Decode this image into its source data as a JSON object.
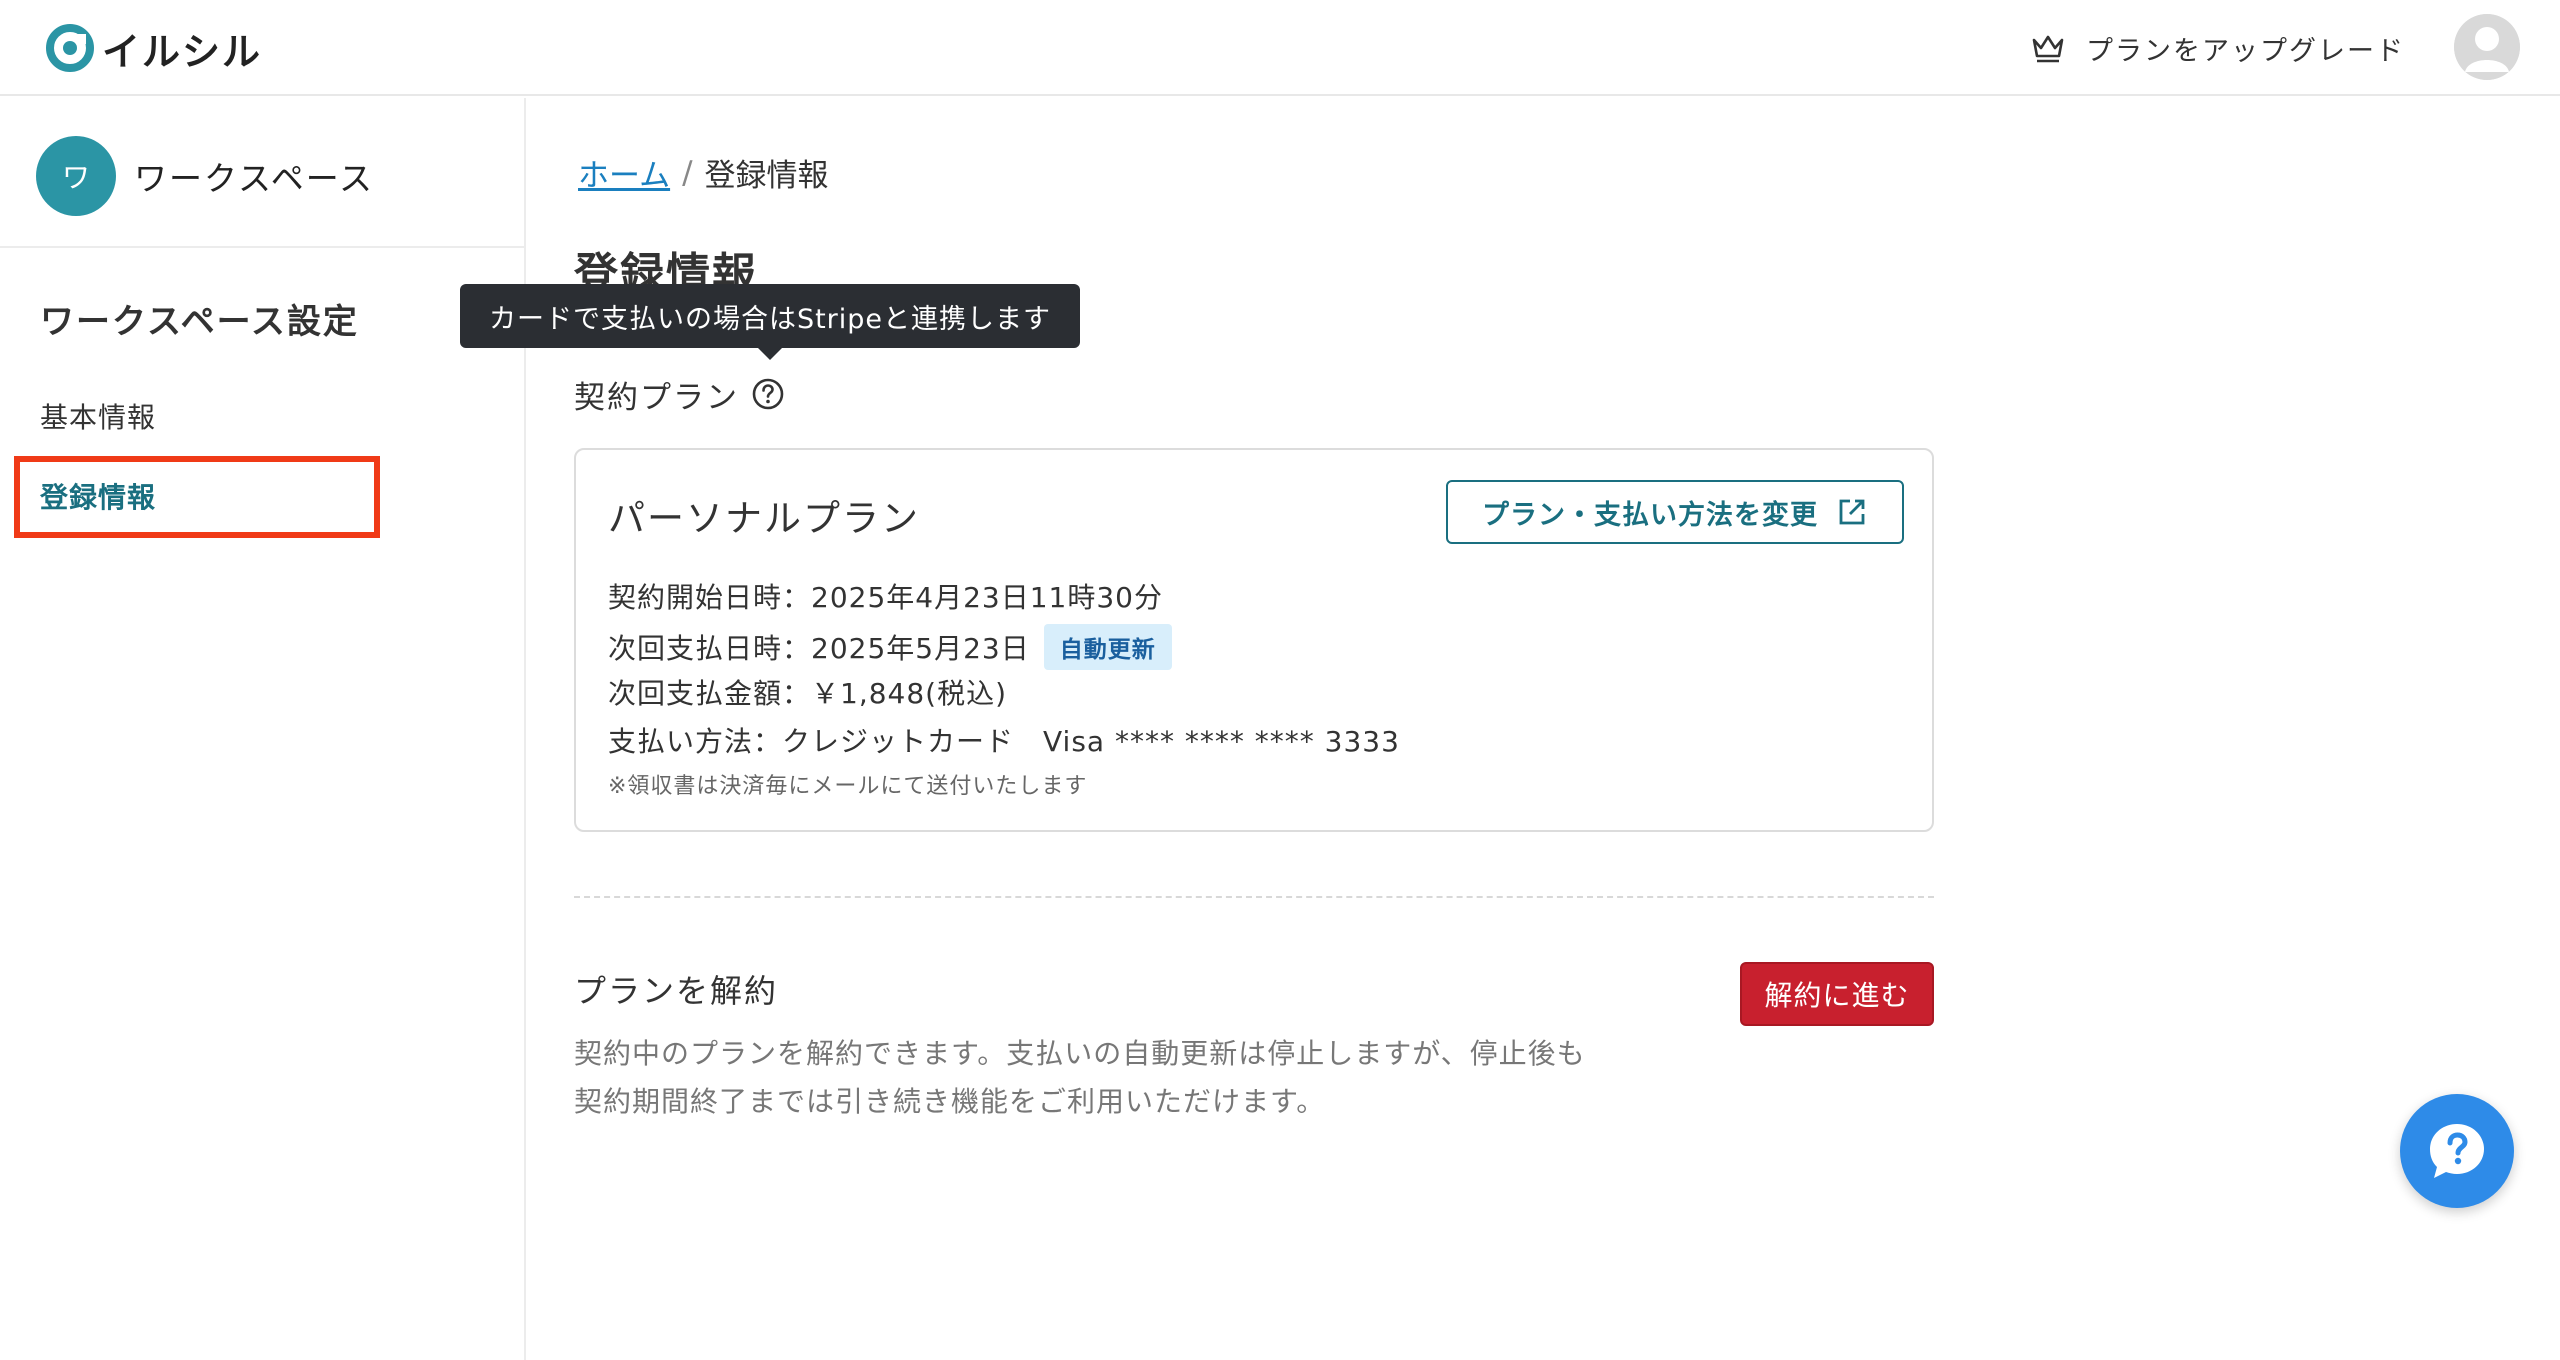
{
  "header": {
    "logo_text": "イルシル",
    "upgrade_label": "プランをアップグレード"
  },
  "sidebar": {
    "workspace_initial": "ワ",
    "workspace_name": "ワークスペース",
    "section_title": "ワークスペース設定",
    "items": [
      {
        "label": "基本情報"
      },
      {
        "label": "登録情報"
      }
    ]
  },
  "breadcrumb": {
    "home": "ホーム",
    "separator": "/",
    "current": "登録情報"
  },
  "page": {
    "title": "登録情報"
  },
  "tooltip": {
    "text": "カードで支払いの場合はStripeと連携します"
  },
  "contract": {
    "label": "契約プラン",
    "plan_name": "パーソナルプラン",
    "change_button": "プラン・支払い方法を変更",
    "start_date": "契約開始日時：2025年4月23日11時30分",
    "next_payment_date": "次回支払日時：2025年5月23日",
    "auto_renew_badge": "自動更新",
    "next_amount": "次回支払金額：￥1,848(税込)",
    "payment_method": "支払い方法：クレジットカード　Visa **** **** **** 3333",
    "note": "※領収書は決済毎にメールにて送付いたします"
  },
  "cancel": {
    "title": "プランを解約",
    "button": "解約に進む",
    "description": "契約中のプランを解約できます。支払いの自動更新は停止しますが、停止後も契約期間終了までは引き続き機能をご利用いただけます。"
  },
  "colors": {
    "accent": "#1a6f80",
    "workspace_avatar": "#2b95a5",
    "danger": "#c8202e",
    "highlight": "#f03a17",
    "chat_button": "#2e8be8"
  }
}
